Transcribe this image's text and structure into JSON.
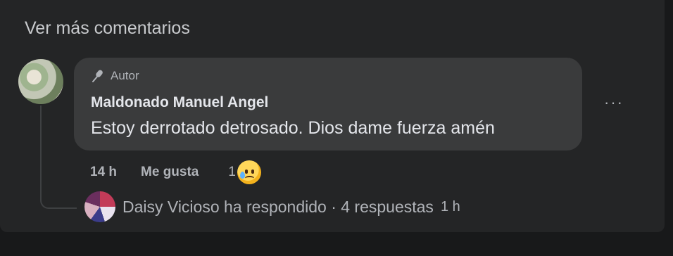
{
  "thread": {
    "see_more_label": "Ver más comentarios"
  },
  "comment": {
    "author_badge": "Autor",
    "author_name": "Maldonado Manuel Angel",
    "text": "Estoy derrotado detrosado. Dios dame fuerza amén",
    "more_label": "···",
    "time": "14 h",
    "like_label": "Me gusta",
    "reaction_count": "1",
    "reaction_icon": "sad-tear-emoji-icon"
  },
  "reply_summary": {
    "text": "Daisy Vicioso ha respondido · 4 respuestas",
    "time": "1 h"
  },
  "colors": {
    "background": "#18191a",
    "panel": "#242526",
    "bubble": "#3a3b3c",
    "primary_text": "#e4e6eb",
    "secondary_text": "#b0b3b8"
  }
}
